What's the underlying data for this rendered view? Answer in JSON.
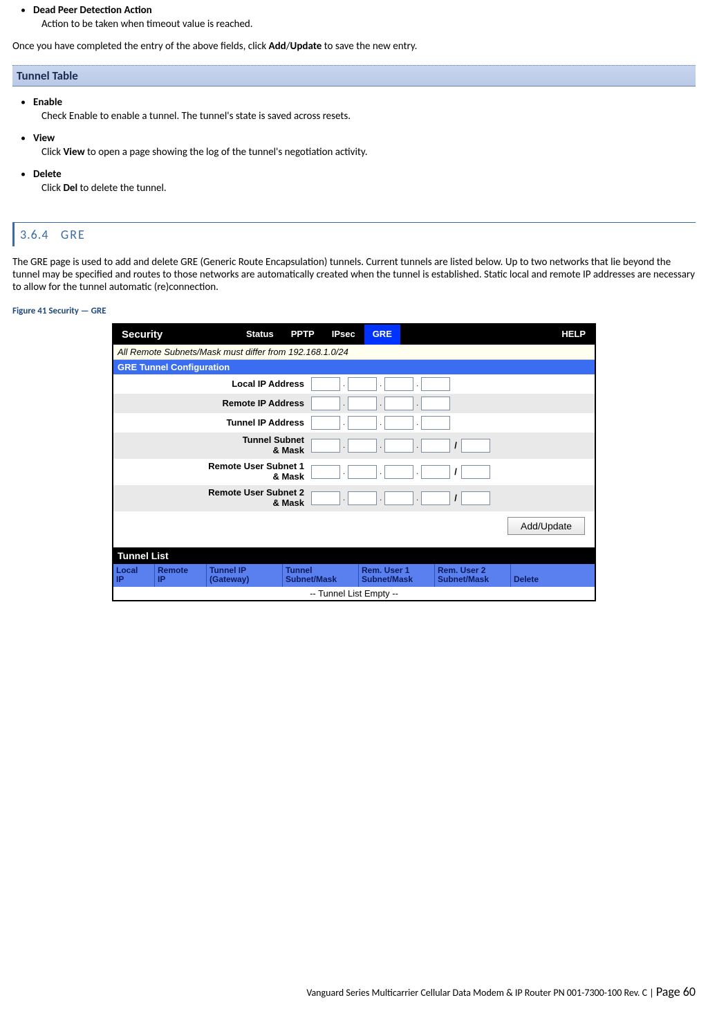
{
  "top": {
    "dpd_title": "Dead Peer Detection Action",
    "dpd_desc": "Action to be taken when timeout value is reached.",
    "completed_pre": "Once you have completed the entry of the above fields, click ",
    "add": "Add",
    "slash": "/",
    "update": "Update",
    "completed_post": " to save the new entry."
  },
  "tunnel_table": {
    "banner": "Tunnel Table",
    "enable_title": "Enable",
    "enable_desc": "Check Enable to enable a tunnel. The tunnel's state is saved across resets.",
    "view_title": "View",
    "view_pre": "Click ",
    "view_bold": "View",
    "view_post": " to open a page showing the log of the tunnel's negotiation activity.",
    "delete_title": "Delete",
    "delete_pre": "Click ",
    "delete_bold": "Del",
    "delete_post": " to delete the tunnel."
  },
  "gre": {
    "num": "3.6.4",
    "title": "GRE",
    "para": "The GRE page is used to add and delete GRE (Generic Route Encapsulation) tunnels. Current tunnels are listed below. Up to two networks that lie beyond the tunnel may be specified and routes to those networks are automatically created when the tunnel is established. Static local and remote IP addresses are necessary to allow for the tunnel automatic (re)connection.",
    "fig_caption": "Figure 41 Security — GRE"
  },
  "figure": {
    "tabs": {
      "security": "Security",
      "status": "Status",
      "pptp": "PPTP",
      "ipsec": "IPsec",
      "gre": "GRE",
      "help": "HELP"
    },
    "note": "All Remote Subnets/Mask must differ from 192.168.1.0/24",
    "section_title": "GRE Tunnel Configuration",
    "labels": {
      "local_ip": "Local IP Address",
      "remote_ip": "Remote IP Address",
      "tunnel_ip": "Tunnel IP Address",
      "tunnel_subnet": "Tunnel Subnet & Mask",
      "remote_sub1": "Remote User Subnet 1 & Mask",
      "remote_sub2": "Remote User Subnet 2 & Mask"
    },
    "btn": "Add/Update",
    "tunnel_list_title": "Tunnel List",
    "th": {
      "c1": "Local IP",
      "c2": "Remote IP",
      "c3": "Tunnel IP (Gateway)",
      "c4": "Tunnel Subnet/Mask",
      "c5": "Rem. User 1 Subnet/Mask",
      "c6": "Rem. User 2 Subnet/Mask",
      "c7": "Delete"
    },
    "empty": "-- Tunnel List Empty --"
  },
  "footer": {
    "text": "Vanguard Series Multicarrier Cellular Data Modem & IP Router PN 001-7300-100 Rev. C",
    "sep": " | ",
    "page_label": "Page 60"
  }
}
